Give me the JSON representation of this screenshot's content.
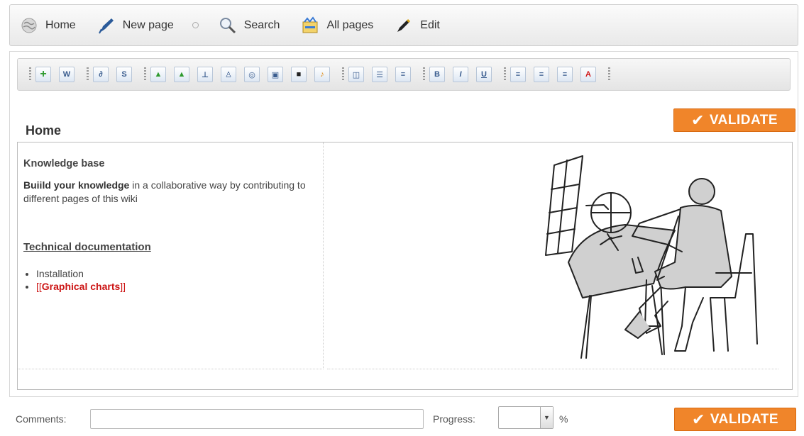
{
  "nav": {
    "items": [
      {
        "label": "Home",
        "icon": "globe-icon"
      },
      {
        "label": "New page",
        "icon": "pen-icon"
      },
      {
        "label": "Search",
        "icon": "magnifier-icon"
      },
      {
        "label": "All pages",
        "icon": "pages-icon"
      },
      {
        "label": "Edit",
        "icon": "pencil-icon"
      }
    ]
  },
  "toolbar": {
    "buttons": [
      {
        "name": "add-icon",
        "glyph": "+"
      },
      {
        "name": "word-icon",
        "glyph": "W"
      },
      {
        "name": "link-icon",
        "glyph": "∂"
      },
      {
        "name": "unlink-icon",
        "glyph": "S"
      },
      {
        "name": "image-icon",
        "glyph": "▲"
      },
      {
        "name": "image-edit-icon",
        "glyph": "▲"
      },
      {
        "name": "diagram-icon",
        "glyph": "⊥"
      },
      {
        "name": "flask-icon",
        "glyph": "♙"
      },
      {
        "name": "compass-icon",
        "glyph": "◎"
      },
      {
        "name": "photo-icon",
        "glyph": "▣"
      },
      {
        "name": "video-icon",
        "glyph": "■"
      },
      {
        "name": "music-icon",
        "glyph": "♪"
      },
      {
        "name": "table-icon",
        "glyph": "◫"
      },
      {
        "name": "list-icon",
        "glyph": "☰"
      },
      {
        "name": "numbered-list-icon",
        "glyph": "≡"
      },
      {
        "name": "bold-icon",
        "glyph": "B"
      },
      {
        "name": "italic-icon",
        "glyph": "I"
      },
      {
        "name": "underline-icon",
        "glyph": "U"
      },
      {
        "name": "align-left-icon",
        "glyph": "≡"
      },
      {
        "name": "align-center-icon",
        "glyph": "≡"
      },
      {
        "name": "align-right-icon",
        "glyph": "≡"
      },
      {
        "name": "font-color-icon",
        "glyph": "A"
      }
    ]
  },
  "validate_label": "VALIDATE",
  "page": {
    "title": "Home",
    "kb_title": "Knowledge base",
    "intro_bold": "Buiild your knowledge",
    "intro_rest": " in a collaborative way by contributing to different pages of this wiki",
    "techdoc_title": "Technical documentation",
    "list_item_1": "Installation",
    "list_item_2_open": "[[",
    "list_item_2_link": "Graphical charts",
    "list_item_2_close": "]]"
  },
  "footer": {
    "comments_label": "Comments:",
    "comments_value": "",
    "progress_label": "Progress:",
    "progress_value": "",
    "percent_sign": "%"
  },
  "colors": {
    "accent": "#f0852a",
    "link_red": "#cc1414"
  }
}
